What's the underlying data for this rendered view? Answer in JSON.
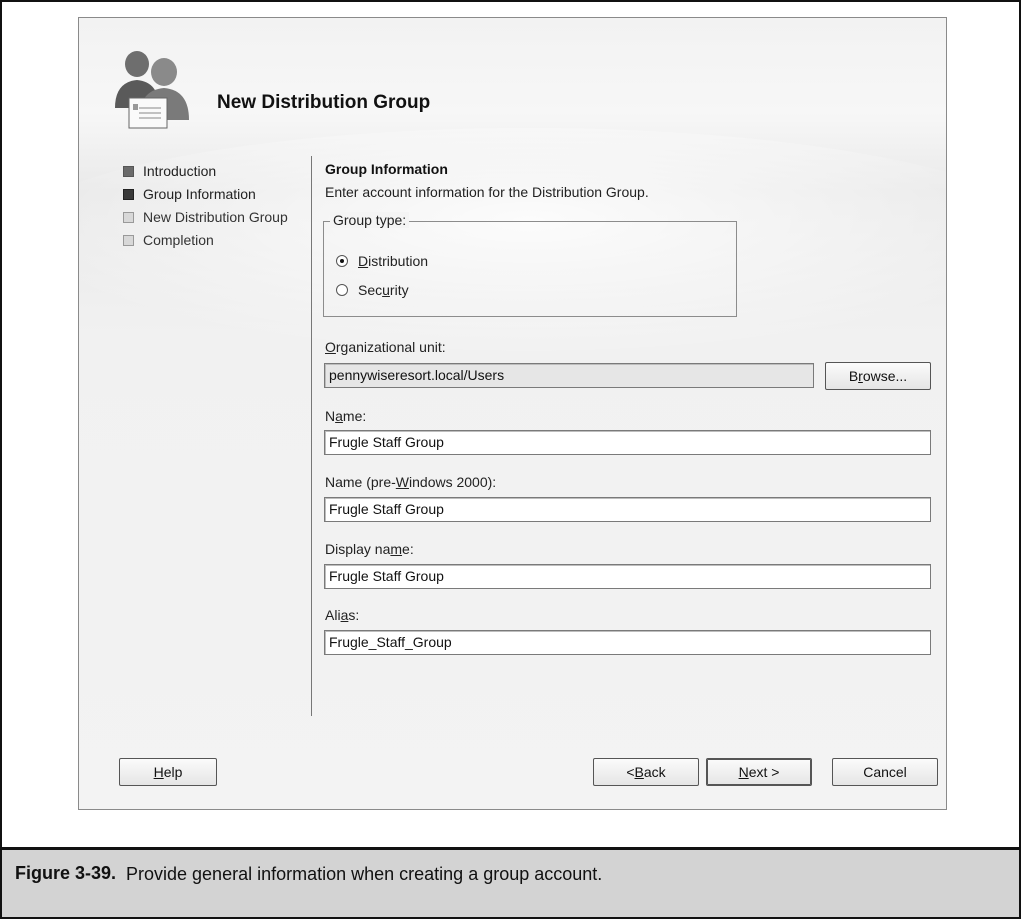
{
  "dialog": {
    "title": "New Distribution Group"
  },
  "steps": [
    {
      "label": "Introduction",
      "state": "done"
    },
    {
      "label": "Group Information",
      "state": "current"
    },
    {
      "label": "New Distribution Group",
      "state": "pending"
    },
    {
      "label": "Completion",
      "state": "pending"
    }
  ],
  "section": {
    "title": "Group Information",
    "description": "Enter account information for the Distribution Group."
  },
  "group_type": {
    "legend": "Group type:",
    "options": [
      {
        "label_pre": "",
        "label_u": "D",
        "label_post": "istribution",
        "selected": true
      },
      {
        "label_pre": "Sec",
        "label_u": "u",
        "label_post": "rity",
        "selected": false
      }
    ]
  },
  "org_unit": {
    "label_pre": "",
    "label_u": "O",
    "label_post": "rganizational unit:",
    "value": "pennywiseresort.local/Users",
    "browse_pre": "B",
    "browse_u": "r",
    "browse_post": "owse..."
  },
  "name": {
    "label_pre": "N",
    "label_u": "a",
    "label_post": "me:",
    "value": "Frugle Staff Group"
  },
  "name_pre2000": {
    "label_pre": "Name (pre-",
    "label_u": "W",
    "label_post": "indows 2000):",
    "value": "Frugle Staff Group"
  },
  "display_name": {
    "label_pre": "Display na",
    "label_u": "m",
    "label_post": "e:",
    "value": "Frugle Staff Group"
  },
  "alias": {
    "label_pre": "Ali",
    "label_u": "a",
    "label_post": "s:",
    "value": "Frugle_Staff_Group"
  },
  "buttons": {
    "help_u": "H",
    "help_post": "elp",
    "back_pre": "< ",
    "back_u": "B",
    "back_post": "ack",
    "next_u": "N",
    "next_post": "ext >",
    "cancel": "Cancel"
  },
  "caption": {
    "label": "Figure 3-39.",
    "text": "Provide general information when creating a group account."
  }
}
